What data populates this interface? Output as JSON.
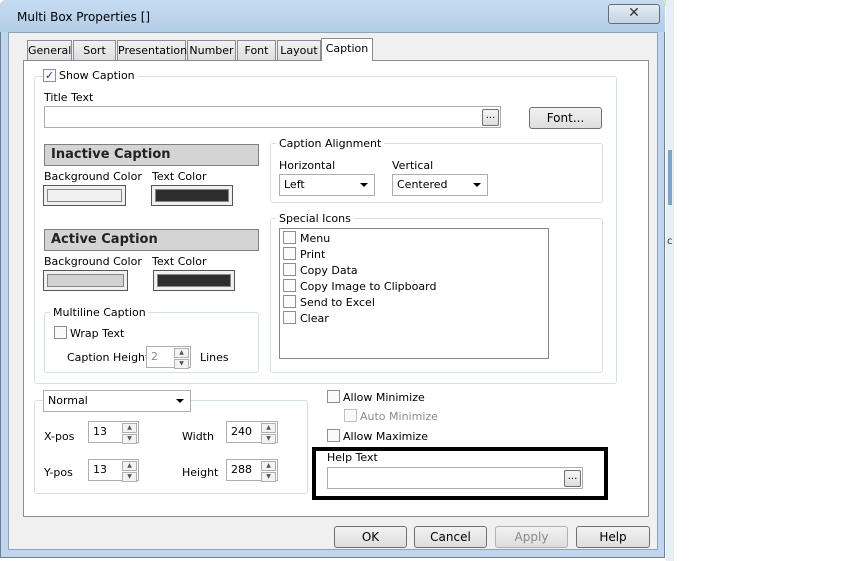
{
  "window": {
    "title": "Multi Box Properties []",
    "close_glyph": "✕"
  },
  "tabs": [
    "General",
    "Sort",
    "Presentation",
    "Number",
    "Font",
    "Layout",
    "Caption"
  ],
  "active_tab": "Caption",
  "caption_tab": {
    "show_caption_label": "Show Caption",
    "show_caption_checked": true,
    "title_text_label": "Title Text",
    "title_text_value": "",
    "ellipsis": "...",
    "font_button": "Font...",
    "inactive_caption": {
      "header": "Inactive Caption",
      "bg_label": "Background Color",
      "text_label": "Text Color",
      "bg_color": "#f0f0f0",
      "text_color": "#2d2d2d"
    },
    "active_caption": {
      "header": "Active Caption",
      "bg_label": "Background Color",
      "text_label": "Text Color",
      "bg_color": "#d2d2d2",
      "text_color": "#2d2d2d"
    },
    "alignment": {
      "group_label": "Caption Alignment",
      "horizontal_label": "Horizontal",
      "horizontal_value": "Left",
      "vertical_label": "Vertical",
      "vertical_value": "Centered"
    },
    "special_icons": {
      "group_label": "Special Icons",
      "items": [
        "Menu",
        "Print",
        "Copy Data",
        "Copy Image to Clipboard",
        "Send to Excel",
        "Clear"
      ]
    },
    "multiline": {
      "group_label": "Multiline Caption",
      "wrap_label": "Wrap Text",
      "height_label": "Caption Height",
      "height_value": "2",
      "lines_label": "Lines"
    },
    "position": {
      "mode_value": "Normal",
      "xpos_label": "X-pos",
      "xpos_value": "13",
      "ypos_label": "Y-pos",
      "ypos_value": "13",
      "width_label": "Width",
      "width_value": "240",
      "height_label": "Height",
      "height_value": "288"
    },
    "allow_minimize_label": "Allow Minimize",
    "auto_minimize_label": "Auto Minimize",
    "allow_maximize_label": "Allow Maximize",
    "help_text_label": "Help Text",
    "help_text_value": ""
  },
  "footer": {
    "ok": "OK",
    "cancel": "Cancel",
    "apply": "Apply",
    "help": "Help"
  },
  "side_fragment": "c"
}
